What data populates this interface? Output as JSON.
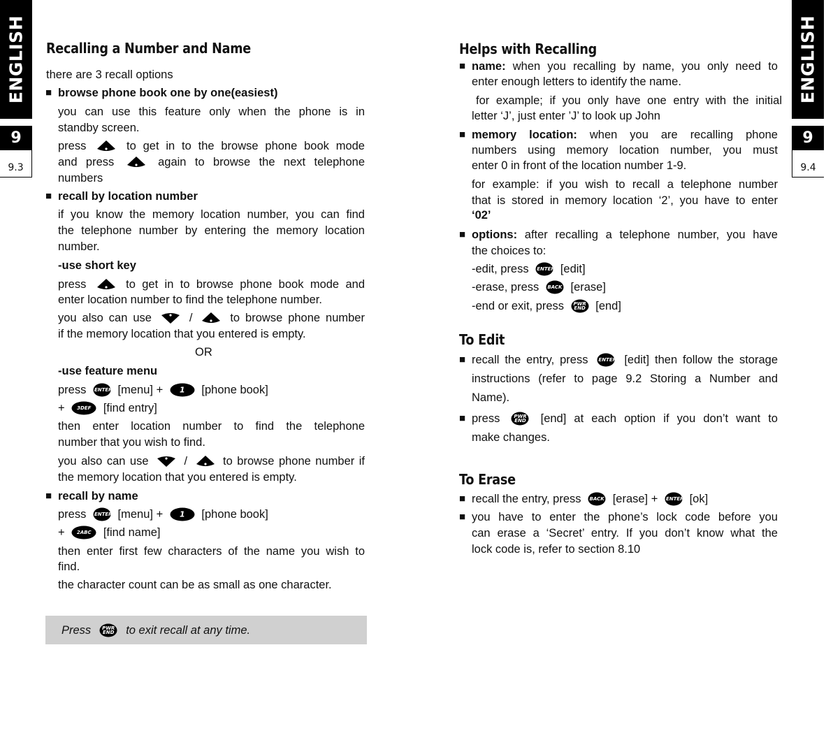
{
  "side_tabs": {
    "language": "ENGLISH",
    "chapter": "9",
    "left_page": "9.3",
    "right_page": "9.4"
  },
  "left": {
    "title": "Recalling a Number and Name",
    "lines": [
      {
        "segs": [
          {
            "t": "there are 3 recall options"
          }
        ]
      },
      {
        "bullet": "■",
        "segs": [
          {
            "t": "browse phone book one by one(easiest)",
            "bold": true
          }
        ]
      },
      {
        "segs": [
          {
            "t": "you can use this feature only when the phone is in"
          }
        ]
      },
      {
        "segs": [
          {
            "t": "standby screen."
          }
        ]
      },
      {
        "segs": [
          {
            "t": "press"
          },
          {
            "icon": "nav-up-key-icon"
          },
          {
            "t": "to get in to the browse phone book mode"
          }
        ]
      },
      {
        "segs": [
          {
            "t": "and press"
          },
          {
            "icon": "nav-up-key-icon"
          },
          {
            "t": "again to browse the next telephone"
          }
        ]
      },
      {
        "segs": [
          {
            "t": "numbers"
          }
        ]
      },
      {
        "bullet": "■",
        "segs": [
          {
            "t": "recall by location number",
            "bold": true
          }
        ]
      },
      {
        "segs": [
          {
            "t": "if you know the memory location number, you can find"
          }
        ]
      },
      {
        "segs": [
          {
            "t": "the telephone number by entering the memory location"
          }
        ]
      },
      {
        "segs": [
          {
            "t": "number."
          }
        ]
      },
      {
        "segs": [
          {
            "t": "-use short key",
            "bold": true
          }
        ]
      },
      {
        "segs": [
          {
            "t": "press"
          },
          {
            "icon": "nav-up-key-icon"
          },
          {
            "t": "to get in to browse phone book mode and"
          }
        ]
      },
      {
        "segs": [
          {
            "t": "enter location number to find the telephone number."
          }
        ]
      },
      {
        "segs": [
          {
            "t": "you also can use"
          },
          {
            "icon": "nav-down-key-icon"
          },
          {
            "t": "/"
          },
          {
            "icon": "nav-up-key-icon"
          },
          {
            "t": "to browse phone number"
          }
        ]
      },
      {
        "segs": [
          {
            "t": "if the memory location that you entered is empty."
          }
        ]
      },
      {
        "segs": [
          {
            "t": "OR"
          }
        ]
      },
      {
        "segs": [
          {
            "t": "-use feature menu",
            "bold": true
          }
        ]
      },
      {
        "segs": [
          {
            "t": "press"
          },
          {
            "icon": "enter-key-icon",
            "label": "ENTER"
          },
          {
            "t": "[menu] +"
          },
          {
            "icon": "one-key-icon",
            "label": "1"
          },
          {
            "t": "[phone book]"
          }
        ]
      },
      {
        "segs": [
          {
            "t": "+"
          },
          {
            "icon": "three-key-icon",
            "label": "3DEF"
          },
          {
            "t": "[find entry]"
          }
        ]
      },
      {
        "segs": [
          {
            "t": "then enter location number to find the telephone"
          }
        ]
      },
      {
        "segs": [
          {
            "t": "number that you wish to find."
          }
        ]
      },
      {
        "segs": [
          {
            "t": "you also can use"
          },
          {
            "icon": "nav-down-key-icon"
          },
          {
            "t": "/"
          },
          {
            "icon": "nav-up-key-icon"
          },
          {
            "t": "to browse phone number if"
          }
        ]
      },
      {
        "segs": [
          {
            "t": "the memory location that you entered is empty."
          }
        ]
      },
      {
        "bullet": "■",
        "segs": [
          {
            "t": "recall by name",
            "bold": true
          }
        ]
      },
      {
        "segs": [
          {
            "t": "press"
          },
          {
            "icon": "enter-key-icon",
            "label": "ENTER"
          },
          {
            "t": "[menu] +"
          },
          {
            "icon": "one-key-icon",
            "label": "1"
          },
          {
            "t": "[phone book]"
          }
        ]
      },
      {
        "segs": [
          {
            "t": "+"
          },
          {
            "icon": "two-key-icon",
            "label": "2ABC"
          },
          {
            "t": "[find name]"
          }
        ]
      },
      {
        "segs": [
          {
            "t": "then enter first few characters of the name you wish to"
          }
        ]
      },
      {
        "segs": [
          {
            "t": "find."
          }
        ]
      },
      {
        "segs": [
          {
            "t": "the character count can be as small as one character."
          }
        ]
      }
    ],
    "note": [
      {
        "t": "Press"
      },
      {
        "icon": "pwr-end-key-icon",
        "label": "PWR END"
      },
      {
        "t": "to exit recall at any time."
      }
    ],
    "note_bg": "#d0d0d0"
  },
  "right": {
    "title": "Helps with Recalling",
    "lines": [
      {
        "bullet": "■",
        "segs": [
          {
            "t": "name:",
            "bold": true
          },
          {
            "t": " when you recalling by name, you only need to"
          }
        ]
      },
      {
        "segs": [
          {
            "t": "enter enough letters to identify the name."
          }
        ]
      },
      {
        "segs": [
          {
            "t": "for example; if you only have one entry with the initial"
          }
        ]
      },
      {
        "segs": [
          {
            "t": "letter ‘J’, just enter ’J’ to look up John"
          }
        ]
      },
      {
        "bullet": "■",
        "segs": [
          {
            "t": "memory location:",
            "bold": true
          },
          {
            "t": " when you are recalling phone"
          }
        ]
      },
      {
        "segs": [
          {
            "t": "numbers using memory location number, you must"
          }
        ]
      },
      {
        "segs": [
          {
            "t": "enter 0 in front of the location number 1-9."
          }
        ]
      },
      {
        "segs": [
          {
            "t": "for example: if you wish to recall a telephone number"
          }
        ]
      },
      {
        "segs": [
          {
            "t": "that is stored in memory location ‘2’, you have to enter"
          }
        ]
      },
      {
        "segs": [
          {
            "t": "‘02’",
            "bold": true
          }
        ]
      },
      {
        "bullet": "■",
        "segs": [
          {
            "t": "options:",
            "bold": true
          },
          {
            "t": " after recalling a telephone number, you have"
          }
        ]
      },
      {
        "segs": [
          {
            "t": "the choices to:"
          }
        ]
      },
      {
        "segs": [
          {
            "t": "-edit, press"
          },
          {
            "icon": "enter-key-icon",
            "label": "ENTER"
          },
          {
            "t": "[edit]"
          }
        ]
      },
      {
        "segs": [
          {
            "t": "-erase, press"
          },
          {
            "icon": "back-key-icon",
            "label": "BACK"
          },
          {
            "t": "[erase]"
          }
        ]
      },
      {
        "segs": [
          {
            "t": "-end or exit, press"
          },
          {
            "icon": "pwr-end-key-icon",
            "label": "PWR END"
          },
          {
            "t": "[end]"
          }
        ]
      }
    ],
    "edit_title": "To Edit",
    "edit_lines": [
      {
        "bullet": "■",
        "segs": [
          {
            "t": "recall the entry, press"
          },
          {
            "icon": "enter-key-icon",
            "label": "ENTER"
          },
          {
            "t": "[edit] then follow the storage"
          }
        ]
      },
      {
        "segs": [
          {
            "t": "instructions (refer to page 9.2 Storing a Number and"
          }
        ]
      },
      {
        "segs": [
          {
            "t": "Name)."
          }
        ]
      },
      {
        "bullet": "■",
        "segs": [
          {
            "t": "press"
          },
          {
            "icon": "pwr-end-key-icon",
            "label": "PWR END"
          },
          {
            "t": "[end] at each option if you don’t want to"
          }
        ]
      },
      {
        "segs": [
          {
            "t": "make changes."
          }
        ]
      }
    ],
    "erase_title": "To Erase",
    "erase_lines": [
      {
        "bullet": "■",
        "segs": [
          {
            "t": "recall the entry, press"
          },
          {
            "icon": "back-key-icon",
            "label": "BACK"
          },
          {
            "t": "[erase] +"
          },
          {
            "icon": "enter-key-icon",
            "label": "ENTER"
          },
          {
            "t": "[ok]"
          }
        ]
      },
      {
        "bullet": "■",
        "segs": [
          {
            "t": "you have to enter the phone’s lock code before you"
          }
        ]
      },
      {
        "segs": [
          {
            "t": "can erase a ‘Secret’ entry. If you don’t know what the"
          }
        ]
      },
      {
        "segs": [
          {
            "t": "lock code is, refer to section 8.10"
          }
        ]
      }
    ]
  }
}
